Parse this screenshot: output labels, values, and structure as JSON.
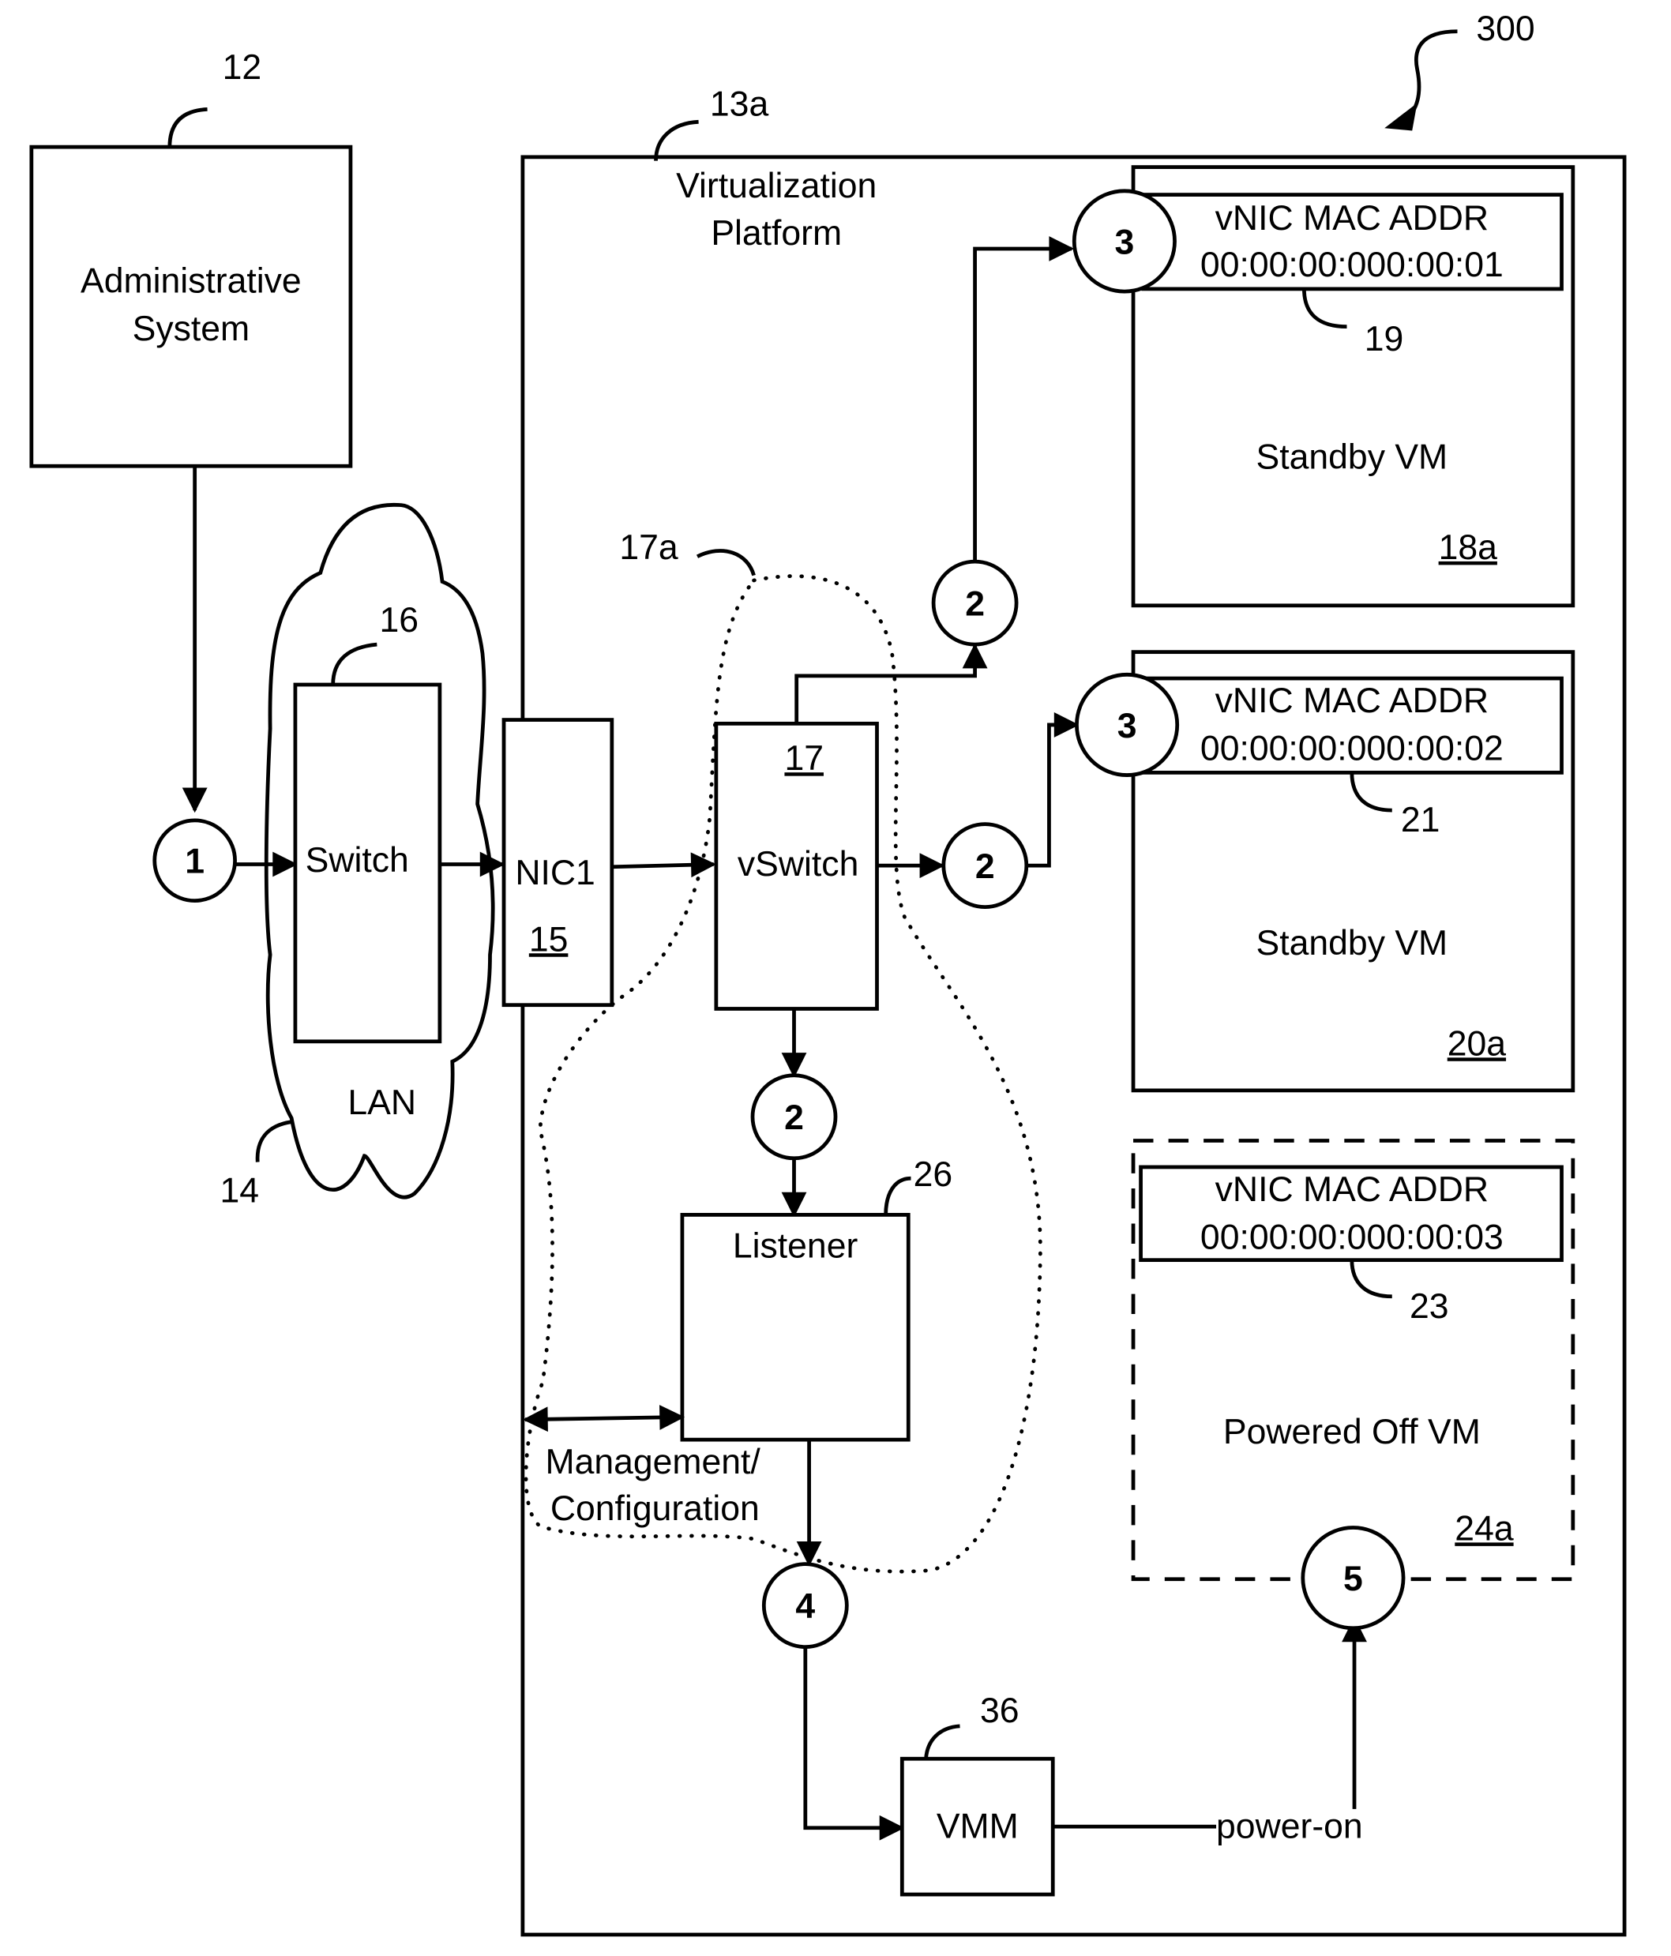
{
  "figure_ref": "300",
  "admin_system": {
    "label_line1": "Administrative",
    "label_line2": "System",
    "ref": "12"
  },
  "lan": {
    "label": "LAN",
    "ref": "14"
  },
  "switch": {
    "label": "Switch",
    "ref": "16"
  },
  "nic": {
    "label": "NIC1",
    "ref": "15"
  },
  "platform": {
    "label_line1": "Virtualization",
    "label_line2": "Platform",
    "ref": "13a"
  },
  "vswitch": {
    "label": "vSwitch",
    "ref": "17",
    "region_ref": "17a"
  },
  "listener": {
    "label": "Listener",
    "ref": "26"
  },
  "mgmt": {
    "label_line1": "Management/",
    "label_line2": "Configuration"
  },
  "vmm": {
    "label": "VMM",
    "ref": "36"
  },
  "power_on": "power-on",
  "vms": [
    {
      "state": "Standby VM",
      "ref": "18a",
      "vnic_title": "vNIC MAC ADDR",
      "mac": "00:00:00:000:00:01",
      "vnic_ref": "19"
    },
    {
      "state": "Standby VM",
      "ref": "20a",
      "vnic_title": "vNIC MAC ADDR",
      "mac": "00:00:00:000:00:02",
      "vnic_ref": "21"
    },
    {
      "state": "Powered Off VM",
      "ref": "24a",
      "vnic_title": "vNIC MAC ADDR",
      "mac": "00:00:00:000:00:03",
      "vnic_ref": "23"
    }
  ],
  "steps": {
    "s1": "1",
    "s2_top": "2",
    "s2_right": "2",
    "s2_down": "2",
    "s3_vm1": "3",
    "s3_vm2": "3",
    "s4": "4",
    "s5": "5"
  }
}
